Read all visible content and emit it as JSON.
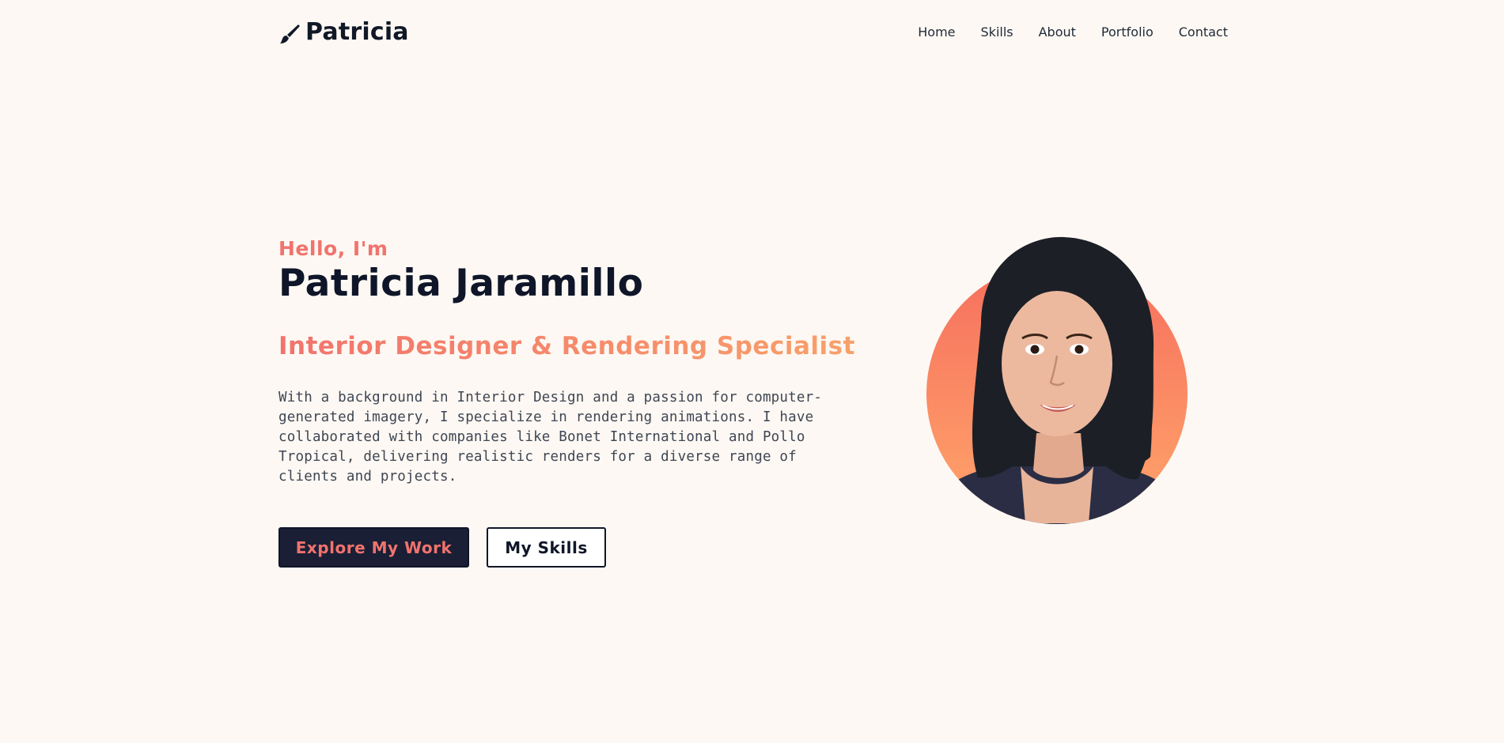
{
  "brand": {
    "name": "Patricia",
    "icon": "paintbrush-icon"
  },
  "nav": {
    "items": [
      {
        "label": "Home"
      },
      {
        "label": "Skills"
      },
      {
        "label": "About"
      },
      {
        "label": "Portfolio"
      },
      {
        "label": "Contact"
      }
    ]
  },
  "hero": {
    "greeting": "Hello, I'm",
    "name": "Patricia Jaramillo",
    "role": "Interior Designer & Rendering Specialist",
    "bio": "With a background in Interior Design and a passion for computer-generated imagery, I specialize in rendering animations. I have collaborated with companies like Bonet International and Pollo Tropical, delivering realistic renders for a diverse range of clients and projects.",
    "primary_button": "Explore My Work",
    "secondary_button": "My Skills"
  },
  "colors": {
    "background": "#fdf8f3",
    "accent": "#f2736d",
    "accent_gradient_end": "#f8a06a",
    "dark": "#0f1629",
    "button_dark": "#1a1f35"
  }
}
